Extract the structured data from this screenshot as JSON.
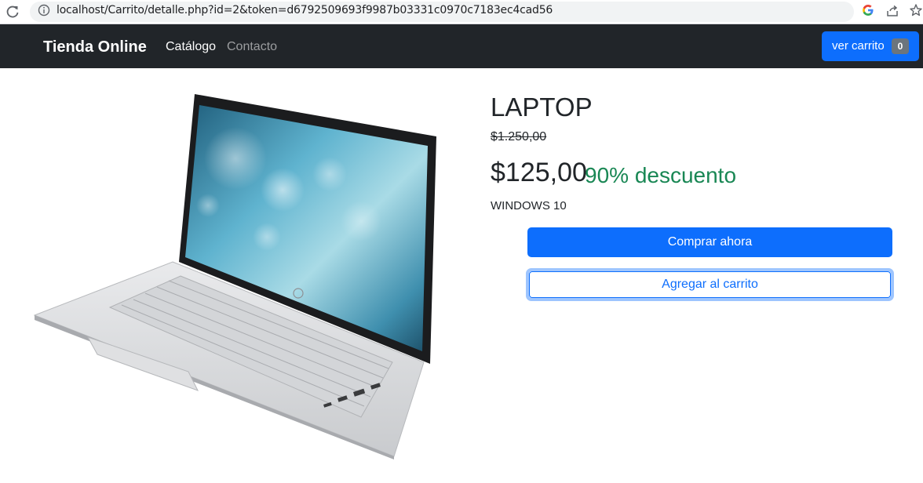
{
  "browser": {
    "url": "localhost/Carrito/detalle.php?id=2&token=d6792509693f9987b03331c0970c7183ec4cad56"
  },
  "navbar": {
    "brand": "Tienda Online",
    "links": [
      "Catálogo",
      "Contacto"
    ],
    "cart_label": "ver carrito",
    "cart_count": "0"
  },
  "product": {
    "name": "LAPTOP",
    "old_price": "$1.250,00",
    "price": "$125,00",
    "discount": "90% descuento",
    "description": "WINDOWS 10",
    "buy_label": "Comprar ahora",
    "add_label": "Agregar al carrito"
  },
  "colors": {
    "navbar_bg": "#212529",
    "primary": "#0d6efd",
    "discount": "#198754"
  }
}
